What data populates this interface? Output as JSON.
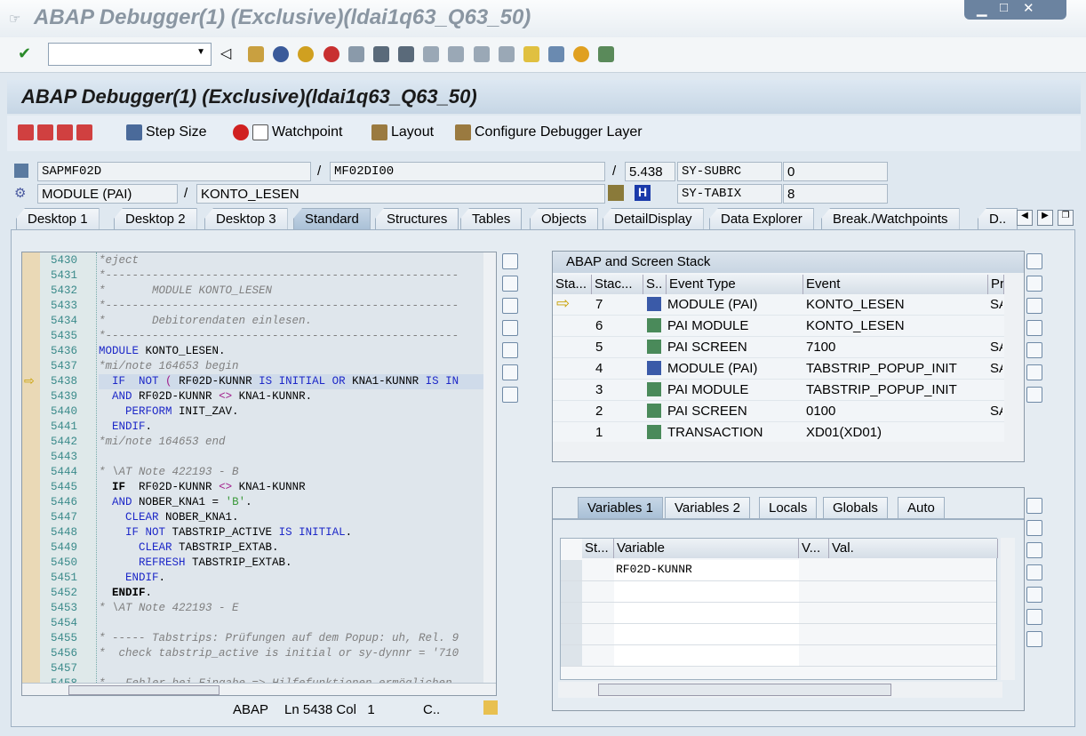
{
  "window": {
    "title": "ABAP Debugger(1)  (Exclusive)(ldai1q63_Q63_50)"
  },
  "header": {
    "title": "ABAP Debugger(1)  (Exclusive)(ldai1q63_Q63_50)"
  },
  "app_toolbar": {
    "step_size": "Step Size",
    "watchpoint": "Watchpoint",
    "layout": "Layout",
    "configure": "Configure Debugger Layer"
  },
  "fields": {
    "program": "SAPMF02D",
    "include": "MF02DI00",
    "line": "5.438",
    "subrc_label": "SY-SUBRC",
    "subrc_value": "0",
    "event_type": "MODULE (PAI)",
    "event": "KONTO_LESEN",
    "tabix_label": "SY-TABIX",
    "tabix_value": "8",
    "slash": "/"
  },
  "tabs": [
    "Desktop 1",
    "Desktop 2",
    "Desktop 3",
    "Standard",
    "Structures",
    "Tables",
    "Objects",
    "DetailDisplay",
    "Data Explorer",
    "Break./Watchpoints",
    "D.."
  ],
  "active_tab": "Standard",
  "code": [
    {
      "n": "5430",
      "h": "<span class='cm'>*eject</span>"
    },
    {
      "n": "5431",
      "h": "<span class='cm'>*-----------------------------------------------------</span>"
    },
    {
      "n": "5432",
      "h": "<span class='cm'>*       MODULE KONTO_LESEN</span>"
    },
    {
      "n": "5433",
      "h": "<span class='cm'>*-----------------------------------------------------</span>"
    },
    {
      "n": "5434",
      "h": "<span class='cm'>*       Debitorendaten einlesen.</span>"
    },
    {
      "n": "5435",
      "h": "<span class='cm'>*-----------------------------------------------------</span>"
    },
    {
      "n": "5436",
      "h": "<span class='k'>MODULE</span> KONTO_LESEN."
    },
    {
      "n": "5437",
      "h": "<span class='cm'>*mi/note 164653 begin</span>"
    },
    {
      "n": "5438",
      "h": "  <span class='k'>IF  NOT</span> <span class='op'>(</span> RF02D-KUNNR <span class='k'>IS INITIAL OR</span> KNA1-KUNNR <span class='k'>IS IN</span>",
      "hl": true
    },
    {
      "n": "5439",
      "h": "  <span class='k'>AND</span> RF02D-KUNNR <span class='op'>&lt;&gt;</span> KNA1-KUNNR."
    },
    {
      "n": "5440",
      "h": "    <span class='k'>PERFORM</span> INIT_ZAV."
    },
    {
      "n": "5441",
      "h": "  <span class='k'>ENDIF</span>."
    },
    {
      "n": "5442",
      "h": "<span class='cm'>*mi/note 164653 end</span>"
    },
    {
      "n": "5443",
      "h": ""
    },
    {
      "n": "5444",
      "h": "<span class='cm'>* \\AT Note 422193 - B</span>"
    },
    {
      "n": "5445",
      "h": "  <b>IF</b>  RF02D-KUNNR <span class='op'>&lt;&gt;</span> KNA1-KUNNR"
    },
    {
      "n": "5446",
      "h": "  <span class='k'>AND</span> NOBER_KNA1 = <span class='st'>'B'</span>."
    },
    {
      "n": "5447",
      "h": "    <span class='k'>CLEAR</span> NOBER_KNA1."
    },
    {
      "n": "5448",
      "h": "    <span class='k'>IF NOT</span> TABSTRIP_ACTIVE <span class='k'>IS INITIAL</span>."
    },
    {
      "n": "5449",
      "h": "      <span class='k'>CLEAR</span> TABSTRIP_EXTAB."
    },
    {
      "n": "5450",
      "h": "      <span class='k'>REFRESH</span> TABSTRIP_EXTAB."
    },
    {
      "n": "5451",
      "h": "    <span class='k'>ENDIF</span>."
    },
    {
      "n": "5452",
      "h": "  <b>ENDIF</b>."
    },
    {
      "n": "5453",
      "h": "<span class='cm'>* \\AT Note 422193 - E</span>"
    },
    {
      "n": "5454",
      "h": ""
    },
    {
      "n": "5455",
      "h": "<span class='cm'>* ----- Tabstrips: Prüfungen auf dem Popup: uh, Rel. 9</span>"
    },
    {
      "n": "5456",
      "h": "<span class='cm'>*  check tabstrip_active is initial or sy-dynnr = '710</span>"
    },
    {
      "n": "5457",
      "h": ""
    },
    {
      "n": "5458",
      "h": "<span class='cm'>*   Fehler bei Eingabe => Hilfefunktionen ermöglichen</span>"
    }
  ],
  "status": {
    "lang": "ABAP",
    "pos": "Ln 5438 Col   1",
    "mode": "C.."
  },
  "stack": {
    "title": "ABAP and Screen Stack",
    "columns": [
      "Sta...",
      "Stac...",
      "S..",
      "Event Type",
      "Event",
      "Pr"
    ],
    "rows": [
      {
        "cur": true,
        "level": "7",
        "type": "MODULE (PAI)",
        "event": "KONTO_LESEN",
        "pr": "SA",
        "icon": "module"
      },
      {
        "cur": false,
        "level": "6",
        "type": "PAI MODULE",
        "event": "KONTO_LESEN",
        "pr": "",
        "icon": "screen"
      },
      {
        "cur": false,
        "level": "5",
        "type": "PAI SCREEN",
        "event": "7100",
        "pr": "SA",
        "icon": "screen"
      },
      {
        "cur": false,
        "level": "4",
        "type": "MODULE (PAI)",
        "event": "TABSTRIP_POPUP_INIT",
        "pr": "SA",
        "icon": "module"
      },
      {
        "cur": false,
        "level": "3",
        "type": "PAI MODULE",
        "event": "TABSTRIP_POPUP_INIT",
        "pr": "",
        "icon": "screen"
      },
      {
        "cur": false,
        "level": "2",
        "type": "PAI SCREEN",
        "event": "0100",
        "pr": "SA",
        "icon": "screen"
      },
      {
        "cur": false,
        "level": "1",
        "type": "TRANSACTION",
        "event": "XD01(XD01)",
        "pr": "",
        "icon": "screen"
      }
    ]
  },
  "vars": {
    "tabs": [
      "Variables 1",
      "Variables 2",
      "Locals",
      "Globals",
      "Auto"
    ],
    "active": "Variables 1",
    "columns": [
      "St...",
      "Variable",
      "V...",
      "Val."
    ],
    "rows": [
      "RF02D-KUNNR",
      "",
      "",
      "",
      ""
    ]
  }
}
